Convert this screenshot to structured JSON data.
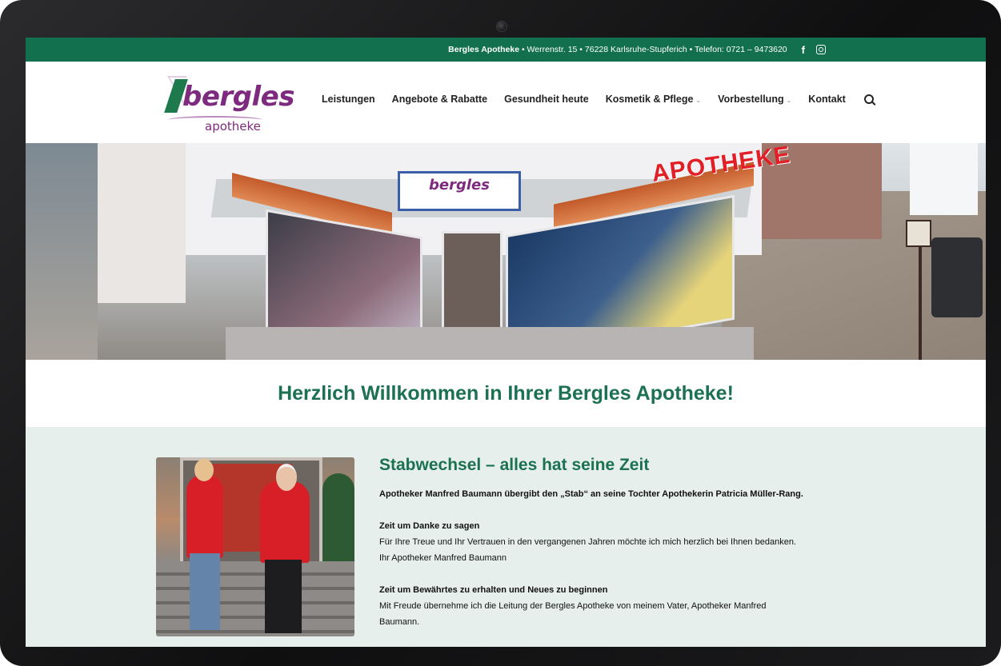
{
  "topbar": {
    "business_name": "Bergles Apotheke",
    "address": " • Werrenstr. 15 • 76228 Karlsruhe-Stupferich • Telefon: 0721 – 9473620",
    "facebook_label": "f"
  },
  "logo": {
    "word": "bergles",
    "sub": "apotheke"
  },
  "nav": {
    "items": [
      {
        "label": "Leistungen"
      },
      {
        "label": "Angebote & Rabatte"
      },
      {
        "label": "Gesundheit heute"
      },
      {
        "label": "Kosmetik & Pflege"
      },
      {
        "label": "Vorbestellung"
      },
      {
        "label": "Kontakt"
      }
    ],
    "caret": "⌄"
  },
  "hero": {
    "sign_logo": "bergles",
    "sign_apotheke": "APOTHEKE"
  },
  "welcome": {
    "title": "Herzlich Willkommen in Ihrer Bergles Apotheke!"
  },
  "article": {
    "title": "Stabwechsel – alles hat seine Zeit",
    "lead": "Apotheker Manfred Baumann übergibt den „Stab“ an seine Tochter Apothekerin Patricia Müller-Rang.",
    "section1_title": "Zeit um Danke zu sagen",
    "section1_line1": "Für Ihre Treue und Ihr Vertrauen in den vergangenen Jahren möchte ich mich herzlich bei Ihnen bedanken.",
    "section1_line2": "Ihr Apotheker Manfred Baumann",
    "section2_title": "Zeit um Bewährtes zu erhalten und Neues zu beginnen",
    "section2_line1": "Mit Freude übernehme ich die Leitung der Bergles Apotheke von meinem Vater, Apotheker Manfred",
    "section2_line2": "Baumann."
  },
  "colors": {
    "brand_green": "#12704f",
    "brand_purple": "#7d2a7f",
    "content_bg": "#e6efec"
  }
}
